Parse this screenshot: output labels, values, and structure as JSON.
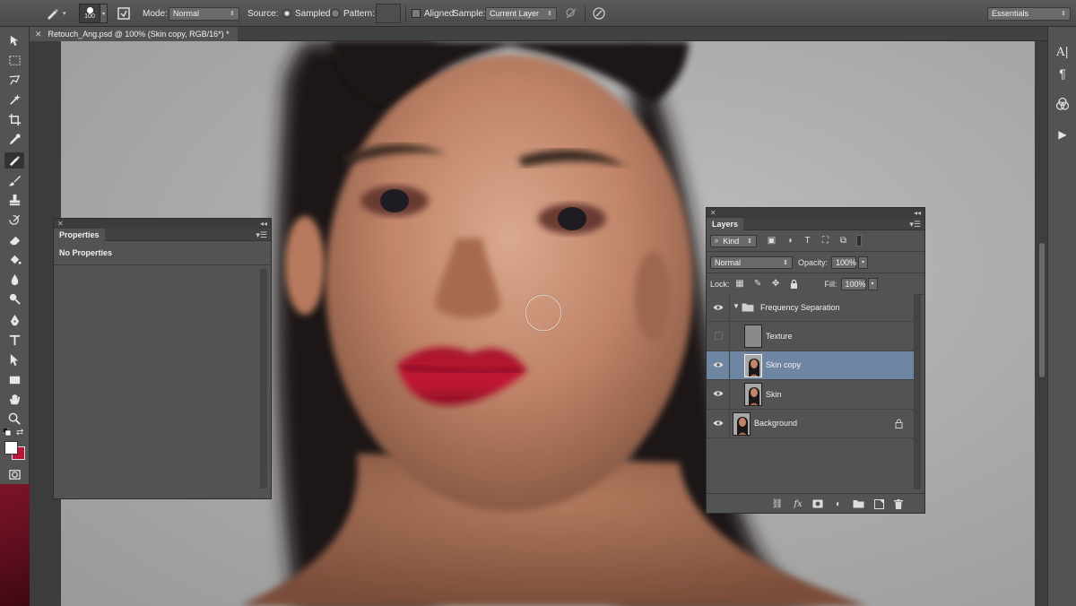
{
  "options_bar": {
    "brush_size": "100",
    "mode_label": "Mode:",
    "mode_value": "Normal",
    "source_label": "Source:",
    "sampled_label": "Sampled",
    "pattern_label": "Pattern:",
    "aligned_label": "Aligned",
    "sample_label": "Sample:",
    "sample_value": "Current Layer",
    "workspace_value": "Essentials"
  },
  "document": {
    "tab_title": "Retouch_Ang.psd @ 100% (Skin copy, RGB/16*) *"
  },
  "properties_panel": {
    "tab_label": "Properties",
    "content_text": "No Properties"
  },
  "layers_panel": {
    "tab_label": "Layers",
    "kind_label": "Kind",
    "blend_mode": "Normal",
    "opacity_label": "Opacity:",
    "opacity_value": "100%",
    "lock_label": "Lock:",
    "fill_label": "Fill:",
    "fill_value": "100%",
    "layers": [
      {
        "name": "Frequency Separation",
        "type": "group",
        "visible": true,
        "selected": false
      },
      {
        "name": "Texture",
        "type": "gray",
        "visible": false,
        "selected": false
      },
      {
        "name": "Skin copy",
        "type": "photo",
        "visible": true,
        "selected": true
      },
      {
        "name": "Skin",
        "type": "photo",
        "visible": true,
        "selected": false
      },
      {
        "name": "Background",
        "type": "photo",
        "visible": true,
        "selected": false,
        "locked": true
      }
    ],
    "footer_icons": [
      "link-layers-icon",
      "fx-icon",
      "add-mask-icon",
      "adjustment-layer-icon",
      "new-group-icon",
      "new-layer-icon",
      "delete-layer-icon"
    ]
  },
  "colors": {
    "foreground": "#ffffff",
    "background": "#b8173a",
    "selected_layer": "#6f86a3"
  }
}
